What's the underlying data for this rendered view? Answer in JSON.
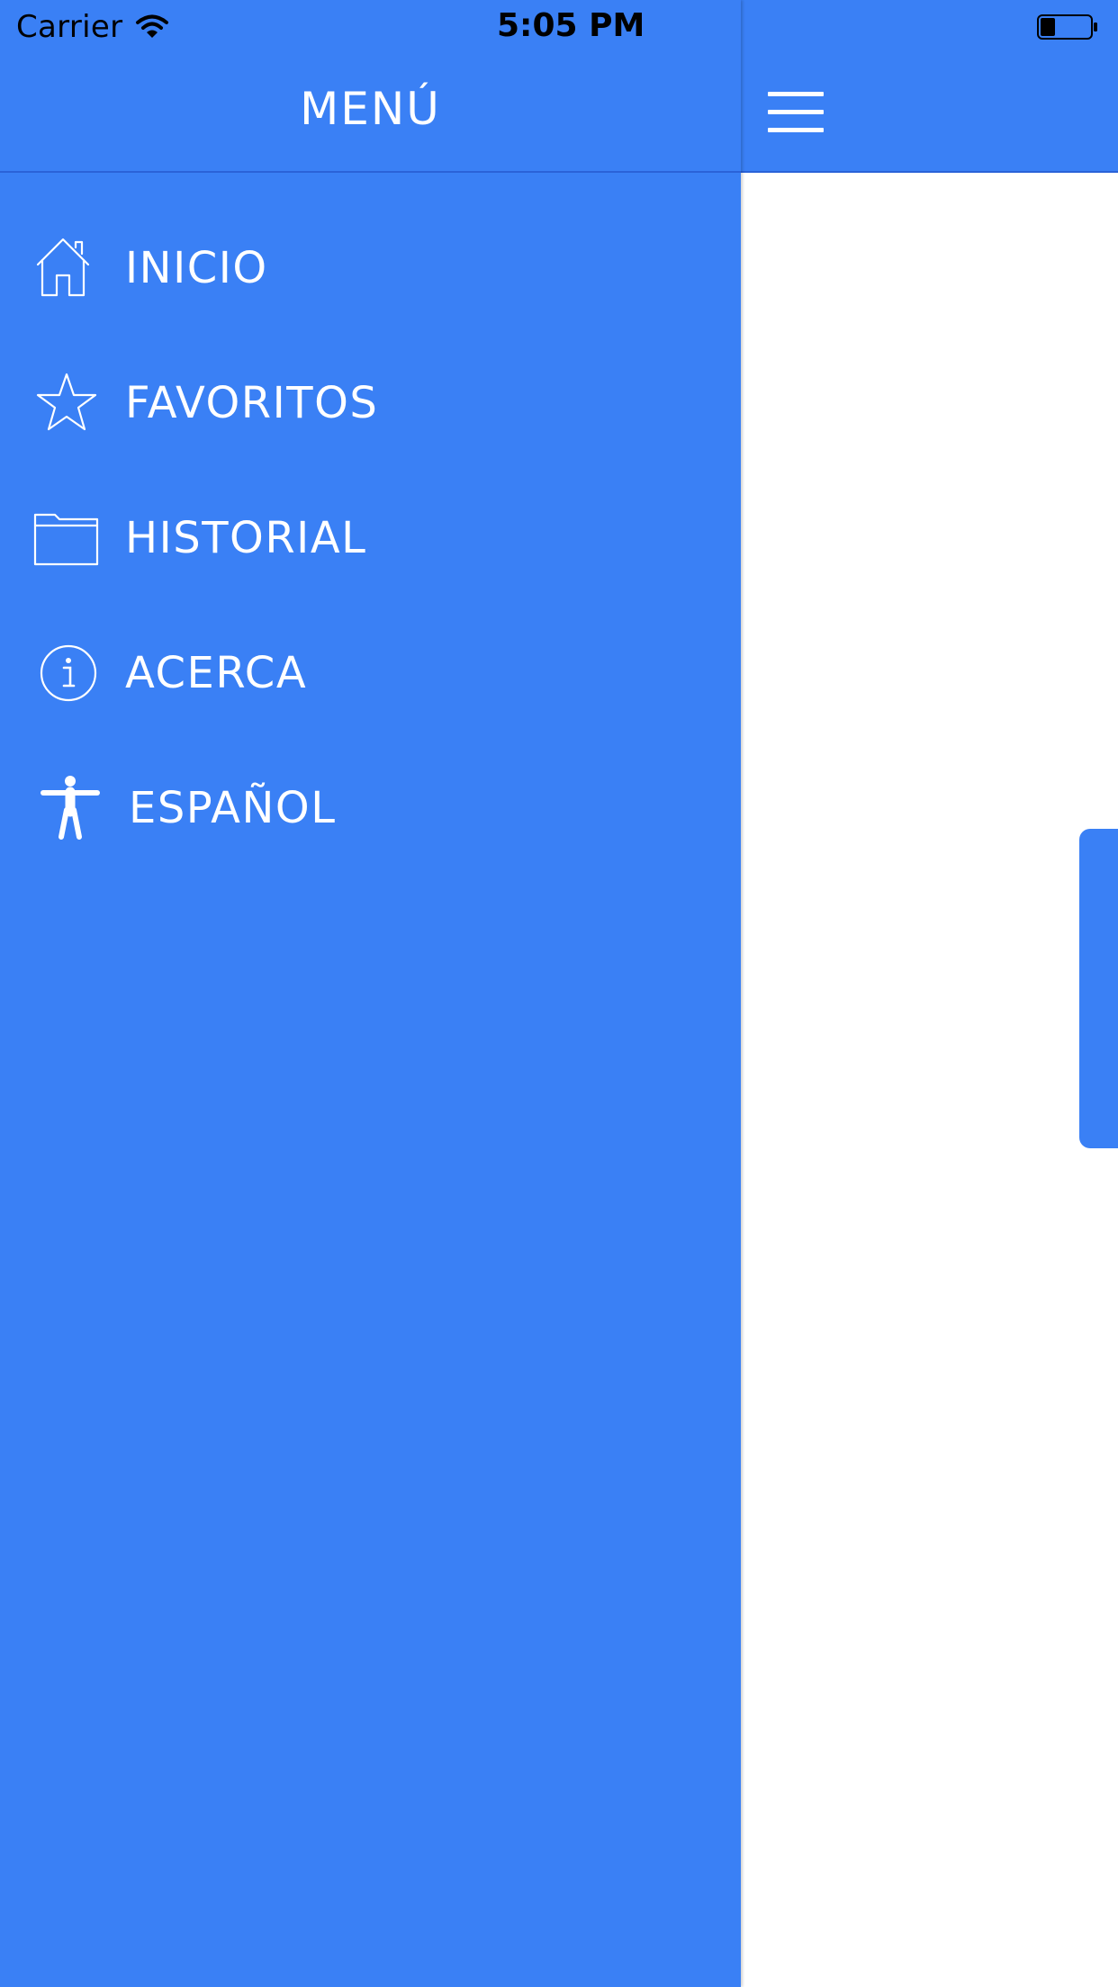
{
  "status_bar": {
    "carrier": "Carrier",
    "time": "5:05 PM",
    "wifi_icon": "wifi-icon",
    "battery_icon": "battery-icon",
    "battery_level": 0.3
  },
  "sidebar": {
    "title": "MENÚ",
    "background_color": "#3A80F5",
    "items": [
      {
        "label": "INICIO",
        "icon": "home-icon"
      },
      {
        "label": "FAVORITOS",
        "icon": "star-icon"
      },
      {
        "label": "HISTORIAL",
        "icon": "folder-icon"
      },
      {
        "label": "ACERCA",
        "icon": "info-icon"
      },
      {
        "label": "ESPAÑOL",
        "icon": "accessibility-icon"
      }
    ]
  },
  "main": {
    "menu_button_icon": "hamburger-icon",
    "accent_color": "#3A80F5"
  }
}
